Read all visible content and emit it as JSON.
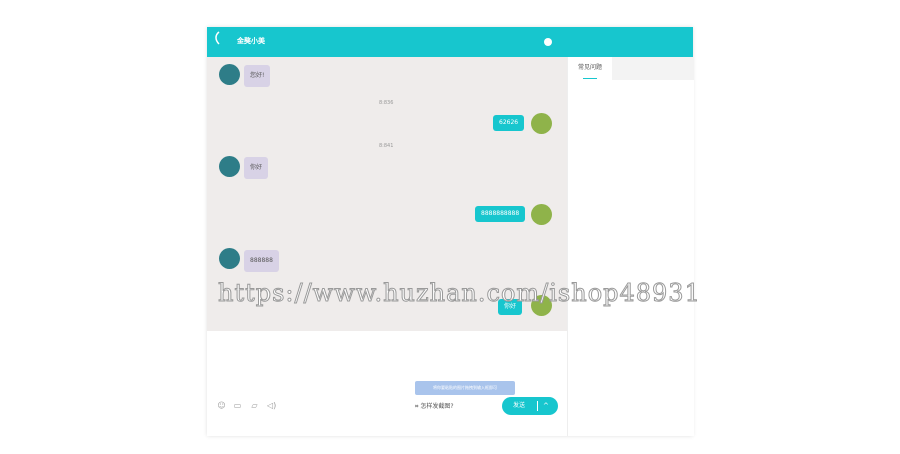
{
  "window": {
    "title": "金獒小美"
  },
  "messages": [
    {
      "side": "left",
      "text": "您好!"
    },
    {
      "time": "8:836"
    },
    {
      "side": "right",
      "text": "62626"
    },
    {
      "time": "8:841"
    },
    {
      "side": "left",
      "text": "你好"
    },
    {
      "side": "right",
      "text": "8888888888"
    },
    {
      "side": "left",
      "text": "888888"
    },
    {
      "side": "right",
      "text": "你好"
    }
  ],
  "input": {
    "hint": "将你要粘贴的图片拖拽到输入框即可",
    "screenshot_label": "怎样发截图?",
    "send_label": "发送",
    "arrow": "^"
  },
  "faq": {
    "tab_label": "常见问题"
  },
  "watermark": "https://www.huzhan.com/ishop48931",
  "colors": {
    "accent": "#17c6ce",
    "chat_bg": "#efeceb",
    "bubble_left": "#d8d2e6"
  }
}
